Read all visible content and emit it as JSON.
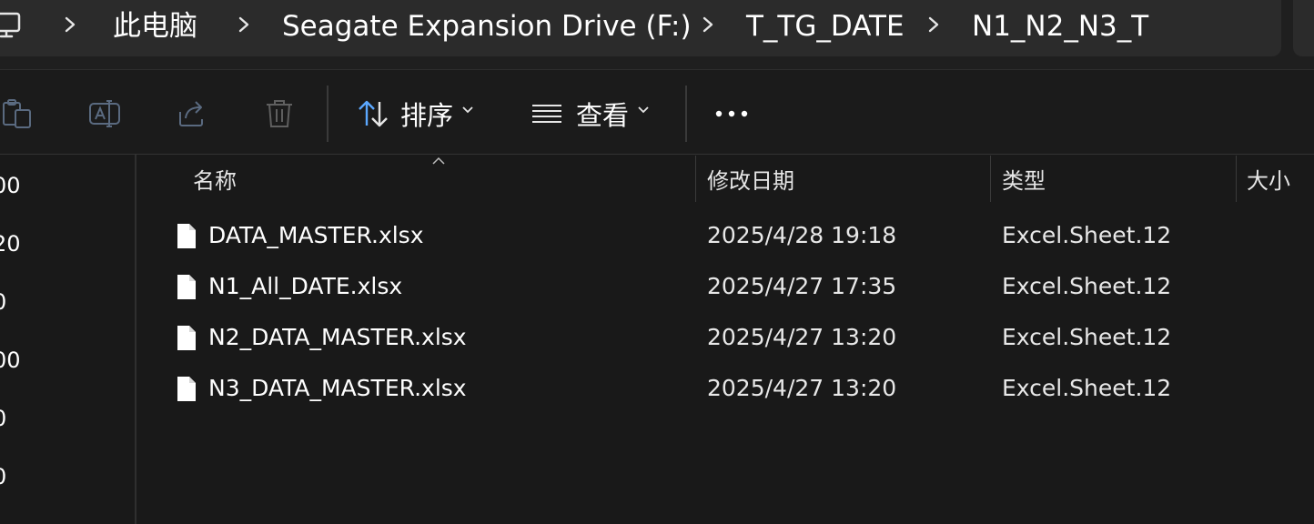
{
  "breadcrumb": {
    "root_icon": "computer-icon",
    "items": [
      "此电脑",
      "Seagate Expansion Drive (F:)",
      "T_TG_DATE",
      "N1_N2_N3_T"
    ]
  },
  "toolbar": {
    "icons": [
      "paste-icon",
      "rename-icon",
      "share-icon",
      "delete-icon"
    ],
    "sort_label": "排序",
    "view_label": "查看",
    "more_icon": "more-icon"
  },
  "nav": {
    "fragments": [
      "00",
      "20",
      "0",
      "00",
      "0",
      "0"
    ]
  },
  "columns": {
    "name": "名称",
    "date": "修改日期",
    "type": "类型",
    "size": "大小",
    "sorted_by": "名称"
  },
  "files": [
    {
      "name": "DATA_MASTER.xlsx",
      "date": "2025/4/28 19:18",
      "type": "Excel.Sheet.12"
    },
    {
      "name": "N1_All_DATE.xlsx",
      "date": "2025/4/27 17:35",
      "type": "Excel.Sheet.12"
    },
    {
      "name": "N2_DATA_MASTER.xlsx",
      "date": "2025/4/27 13:20",
      "type": "Excel.Sheet.12"
    },
    {
      "name": "N3_DATA_MASTER.xlsx",
      "date": "2025/4/27 13:20",
      "type": "Excel.Sheet.12"
    }
  ],
  "colors": {
    "background": "#191919",
    "address_bar": "#2b2b2b",
    "accent_sort_arrow": "#5ba8ff"
  }
}
